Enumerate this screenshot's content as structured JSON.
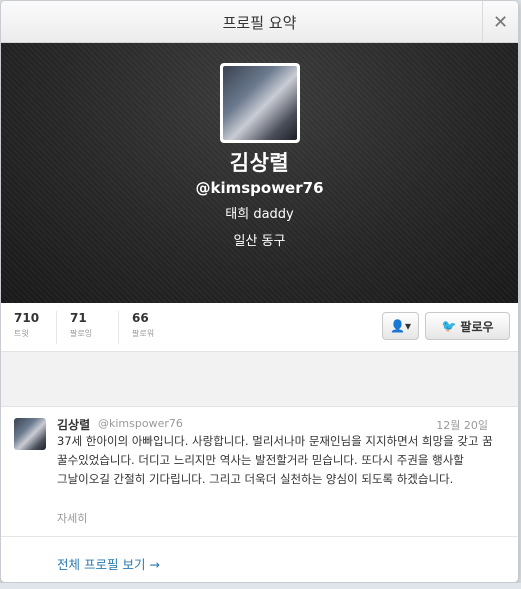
{
  "modal": {
    "title": "프로필 요약",
    "close_glyph": "✕"
  },
  "profile": {
    "name": "김상렬",
    "handle": "@kimspower76",
    "bio": "태희 daddy",
    "location": "일산 동구"
  },
  "stats": [
    {
      "value": "710",
      "label": "트윗"
    },
    {
      "value": "71",
      "label": "팔로잉"
    },
    {
      "value": "66",
      "label": "팔로워"
    }
  ],
  "actions": {
    "user_menu_glyph": "👤▾",
    "follow_label": "팔로우",
    "follow_icon": "twitter-bird-icon"
  },
  "tweet": {
    "name": "김상렬",
    "handle": "@kimspower76",
    "date": "12월 20일",
    "text": "37세 한아이의 아빠입니다. 사랑합니다. 멀리서나마 문재인님을 지지하면서 희망을 갖고 꿈 꿀수있었습니다. 더디고 느리지만 역사는 발전할거라 믿습니다. 또다시 주권을 행사할 그날이오길 간절히 기다립니다. 그리고 더욱더 실천하는 양심이 되도록 하겠습니다.",
    "more_label": "자세히"
  },
  "footer": {
    "full_profile_label": "전체 프로필 보기 →"
  },
  "colors": {
    "link": "#2a7ab0",
    "twitter_blue": "#2fa6e0",
    "header_dark": "#262626"
  }
}
